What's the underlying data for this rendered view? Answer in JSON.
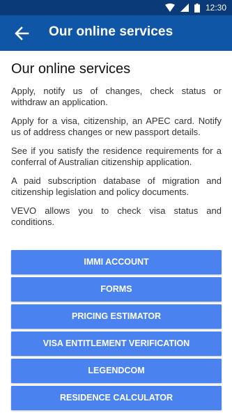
{
  "status_bar": {
    "time": "12:30"
  },
  "app_bar": {
    "title": "Our online services"
  },
  "page": {
    "title": "Our online services",
    "paragraphs": [
      "Apply, notify us of changes, check status or withdraw an application.",
      "Apply for a visa, citizenship, an APEC card. Notify us of address changes or new passport details.",
      "See if you satisfy the residence requirements for a conferral of Australian citizenship application.",
      "A paid subscription database of migration and citizenship legislation and policy documents.",
      "VEVO allows you to check visa status and conditions."
    ]
  },
  "buttons": [
    "IMMI ACCOUNT",
    "FORMS",
    "PRICING ESTIMATOR",
    "VISA ENTITLEMENT VERIFICATION",
    "LEGENDCOM",
    "RESIDENCE CALCULATOR"
  ],
  "colors": {
    "status_bar": "#0a3a78",
    "app_bar": "#0f57a6",
    "button": "#4a83f0"
  }
}
